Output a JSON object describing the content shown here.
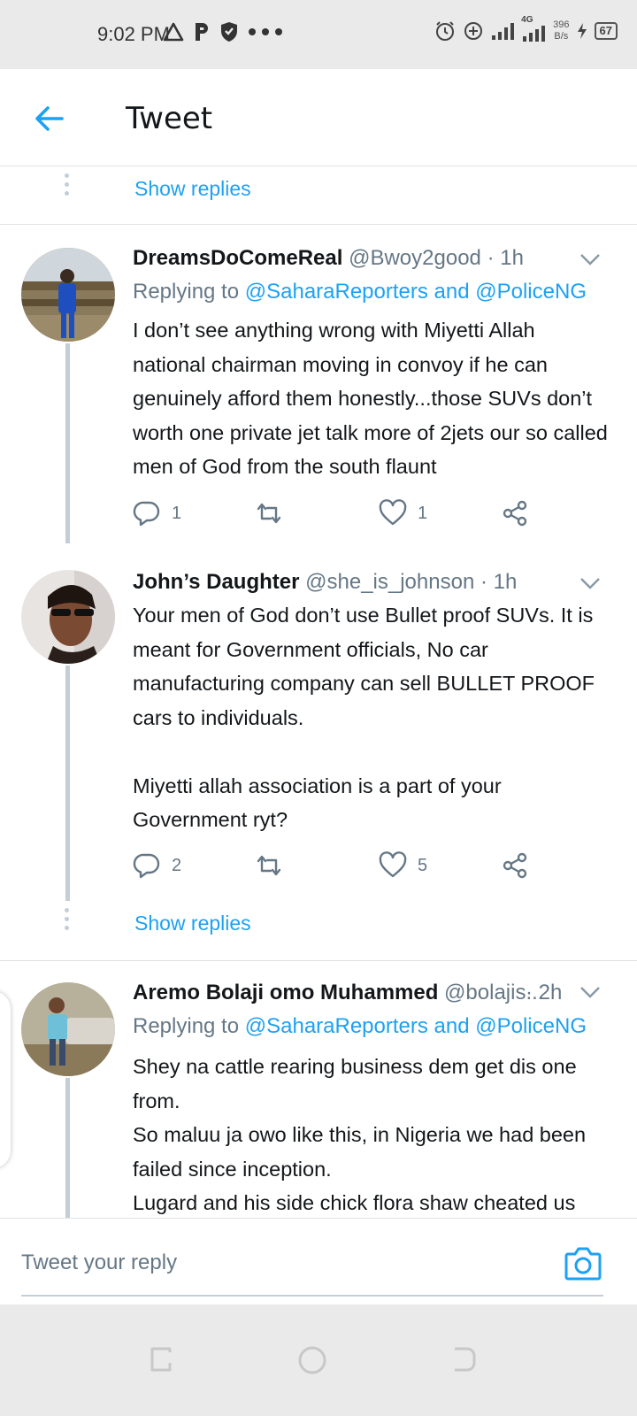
{
  "status_bar": {
    "time": "9:02 PM",
    "network": "4G",
    "speed_value": "396",
    "speed_unit": "B/s",
    "battery": "67"
  },
  "header": {
    "title": "Tweet"
  },
  "thread": {
    "show_replies_label": "Show replies",
    "tweets": [
      {
        "display_name": "DreamsDoComeReal",
        "handle": "@Bwoy2good",
        "time": "· 1h",
        "replying_prefix": "Replying to",
        "replying_mentions": "@SaharaReporters and @PoliceNG",
        "text": "I don’t see anything wrong with Miyetti Allah national chairman moving in convoy if he can genuinely afford them honestly...those SUVs don’t worth one private jet talk more of 2jets our so called men of God from the south flaunt",
        "reply_count": "1",
        "retweet_count": "",
        "like_count": "1"
      },
      {
        "display_name": "John’s Daughter",
        "handle": "@she_is_johnson",
        "time": "· 1h",
        "text": "Your men of God don’t use Bullet proof SUVs. It is meant for Government officials, No car manufacturing company can sell BULLET PROOF cars to individuals.\n\nMiyetti allah association is a part of your Government ryt?",
        "reply_count": "2",
        "retweet_count": "",
        "like_count": "5"
      },
      {
        "display_name": "Aremo Bolaji omo Muhammed",
        "handle": "@bolajis...",
        "time": "· 2h",
        "replying_prefix": "Replying to",
        "replying_mentions": "@SaharaReporters and @PoliceNG",
        "text": "Shey na cattle rearing business dem get  dis one from.\nSo maluu ja owo like this,  in Nigeria we had been failed since inception.\nLugard and his side chick flora shaw cheated us"
      }
    ]
  },
  "reply_bar": {
    "placeholder": "Tweet your reply"
  },
  "colors": {
    "accent": "#1da1f2",
    "secondary_text": "#657786",
    "divider": "#dfe3e6",
    "thread_line": "#c4ced6"
  }
}
